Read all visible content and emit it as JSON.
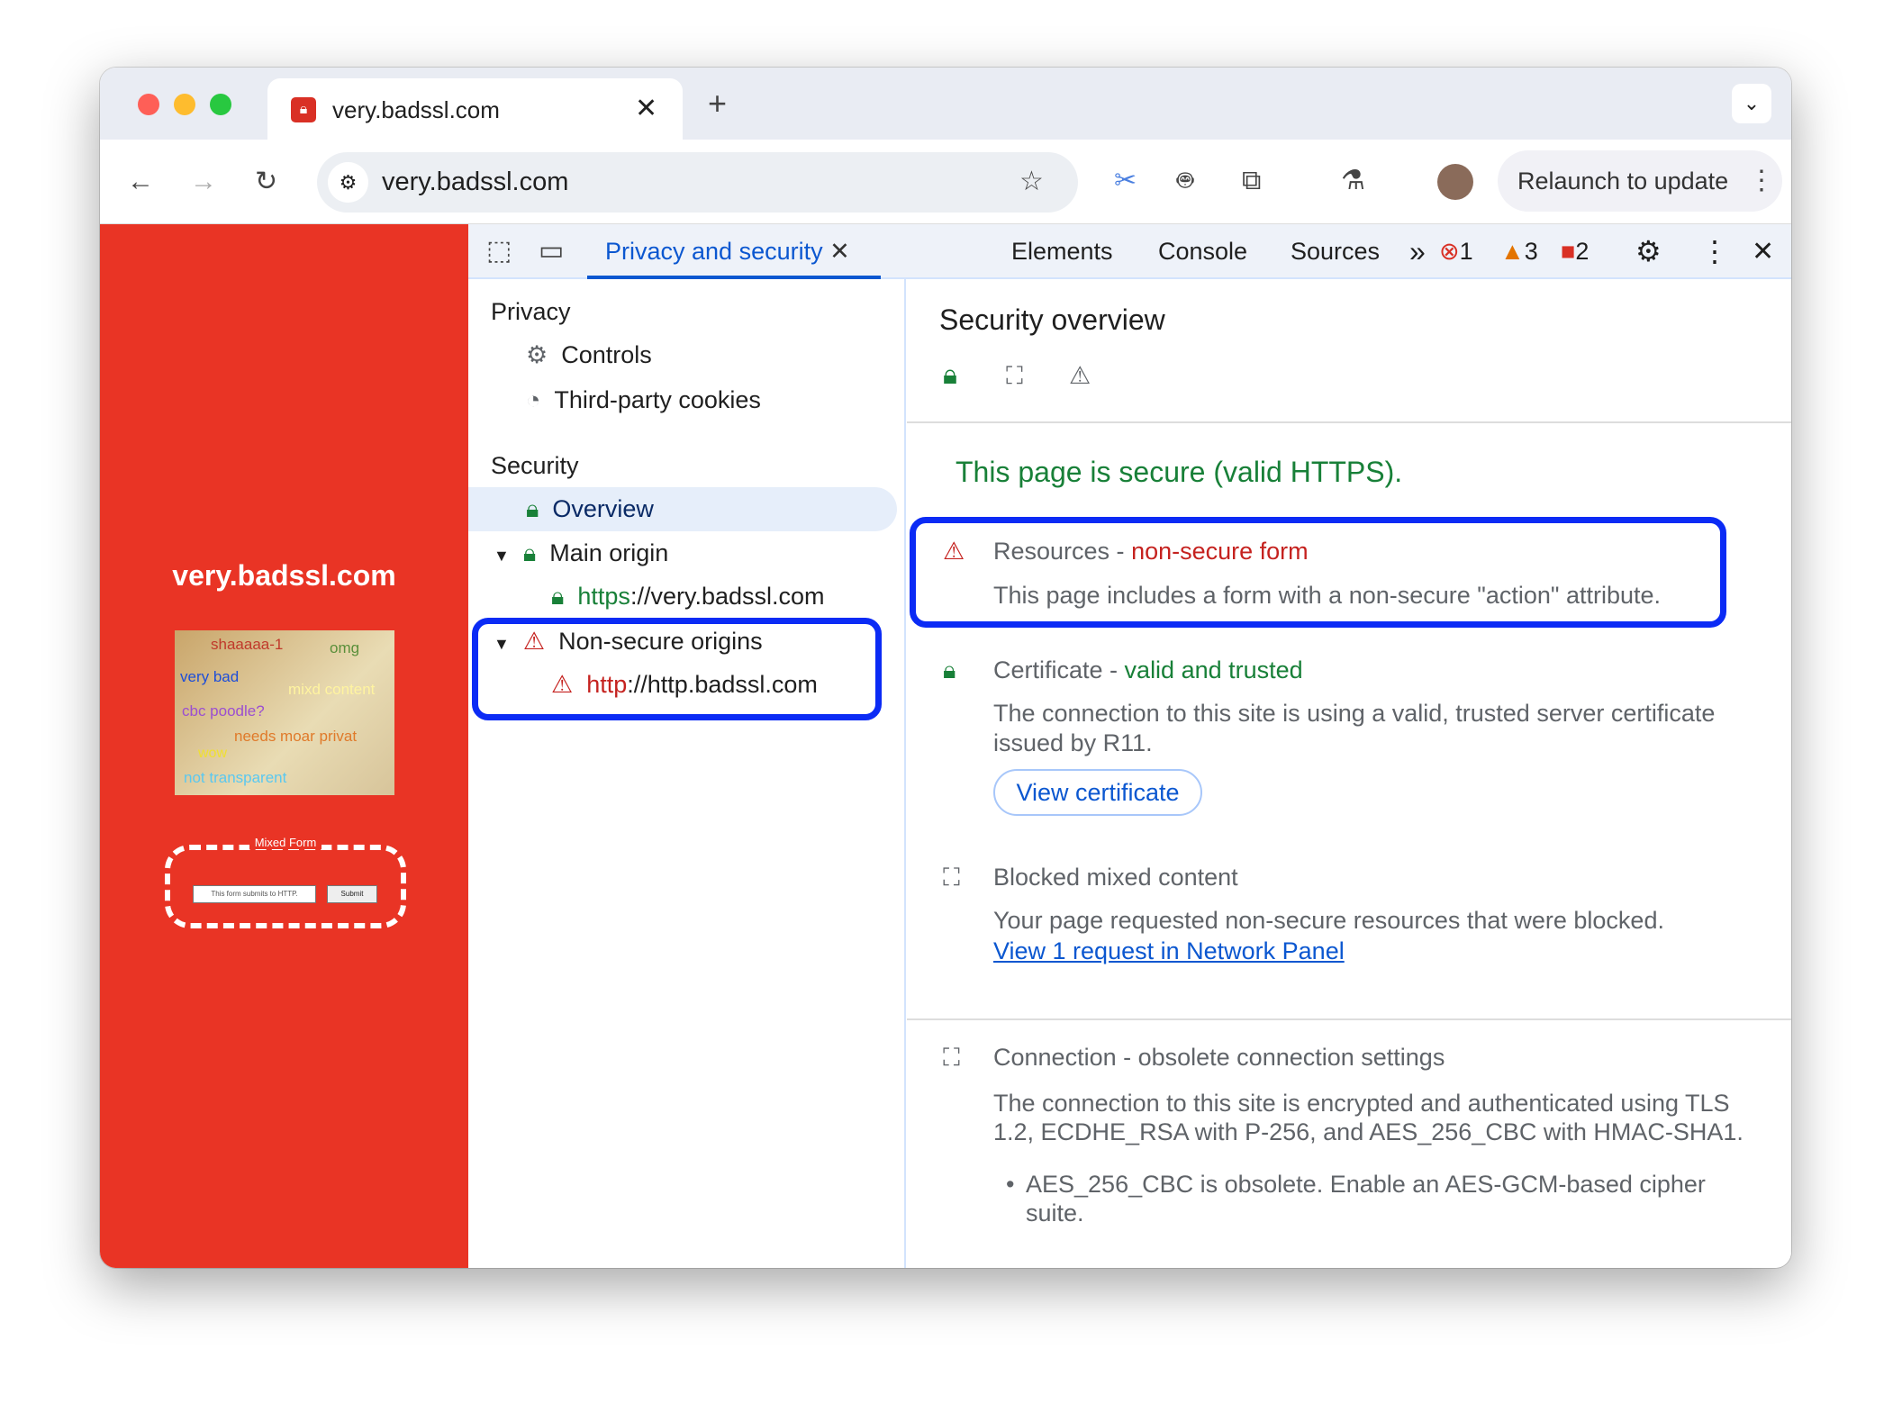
{
  "browser": {
    "tab_title": "very.badssl.com",
    "url": "very.badssl.com",
    "relaunch_label": "Relaunch to update",
    "toolbar_icons": [
      "back-icon",
      "forward-icon",
      "reload-icon",
      "site-info-icon",
      "star-icon",
      "scissors-icon",
      "robot-icon",
      "extensions-icon",
      "flask-icon",
      "avatar",
      "more-icon"
    ]
  },
  "page": {
    "site_title": "very.badssl.com",
    "doge_words": [
      "shaaaaa-1",
      "omg",
      "very bad",
      "mixd content",
      "cbc poodle?",
      "needs moar privat",
      "wow",
      "not transparent"
    ],
    "form_legend": "Mixed Form",
    "form_input_value": "This form submits to HTTP.",
    "form_submit": "Submit"
  },
  "devtools": {
    "tabs": [
      {
        "label": "Privacy and security",
        "active": true
      },
      {
        "label": "Elements"
      },
      {
        "label": "Console"
      },
      {
        "label": "Sources"
      }
    ],
    "more_tabs": "»",
    "counts": {
      "errors": "1",
      "warnings": "3",
      "issues": "2"
    },
    "sidebar": {
      "privacy_heading": "Privacy",
      "controls": "Controls",
      "third_party": "Third-party cookies",
      "security_heading": "Security",
      "overview": "Overview",
      "main_origin": "Main origin",
      "main_origin_scheme": "https",
      "main_origin_host": "://very.badssl.com",
      "non_secure": "Non-secure origins",
      "nonsecure_scheme": "http",
      "nonsecure_host": "://http.badssl.com"
    },
    "main": {
      "title": "Security overview",
      "summary": "This page is secure (valid HTTPS).",
      "resources_title": "Resources - ",
      "resources_status": "non-secure form",
      "resources_desc": "This page includes a form with a non-secure \"action\" attribute.",
      "cert_title": "Certificate - ",
      "cert_status": "valid and trusted",
      "cert_desc1": "The connection to this site is using a valid, trusted server certificate",
      "cert_desc2": "issued by R11.",
      "view_cert": "View certificate",
      "mixed_title": "Blocked mixed content",
      "mixed_desc": "Your page requested non-secure resources that were blocked.",
      "mixed_link": "View 1 request in Network Panel",
      "conn_title": "Connection - obsolete connection settings",
      "conn_desc1": "The connection to this site is encrypted and authenticated using TLS",
      "conn_desc2": "1.2, ECDHE_RSA with P-256, and AES_256_CBC with HMAC-SHA1.",
      "conn_bullet1": "AES_256_CBC is obsolete. Enable an AES-GCM-based cipher",
      "conn_bullet2": "suite."
    }
  },
  "colors": {
    "secure": "#188038",
    "danger": "#c5221f",
    "accent": "#0b57d0",
    "highlight": "#0b2bf5",
    "page_bg": "#e93425"
  }
}
